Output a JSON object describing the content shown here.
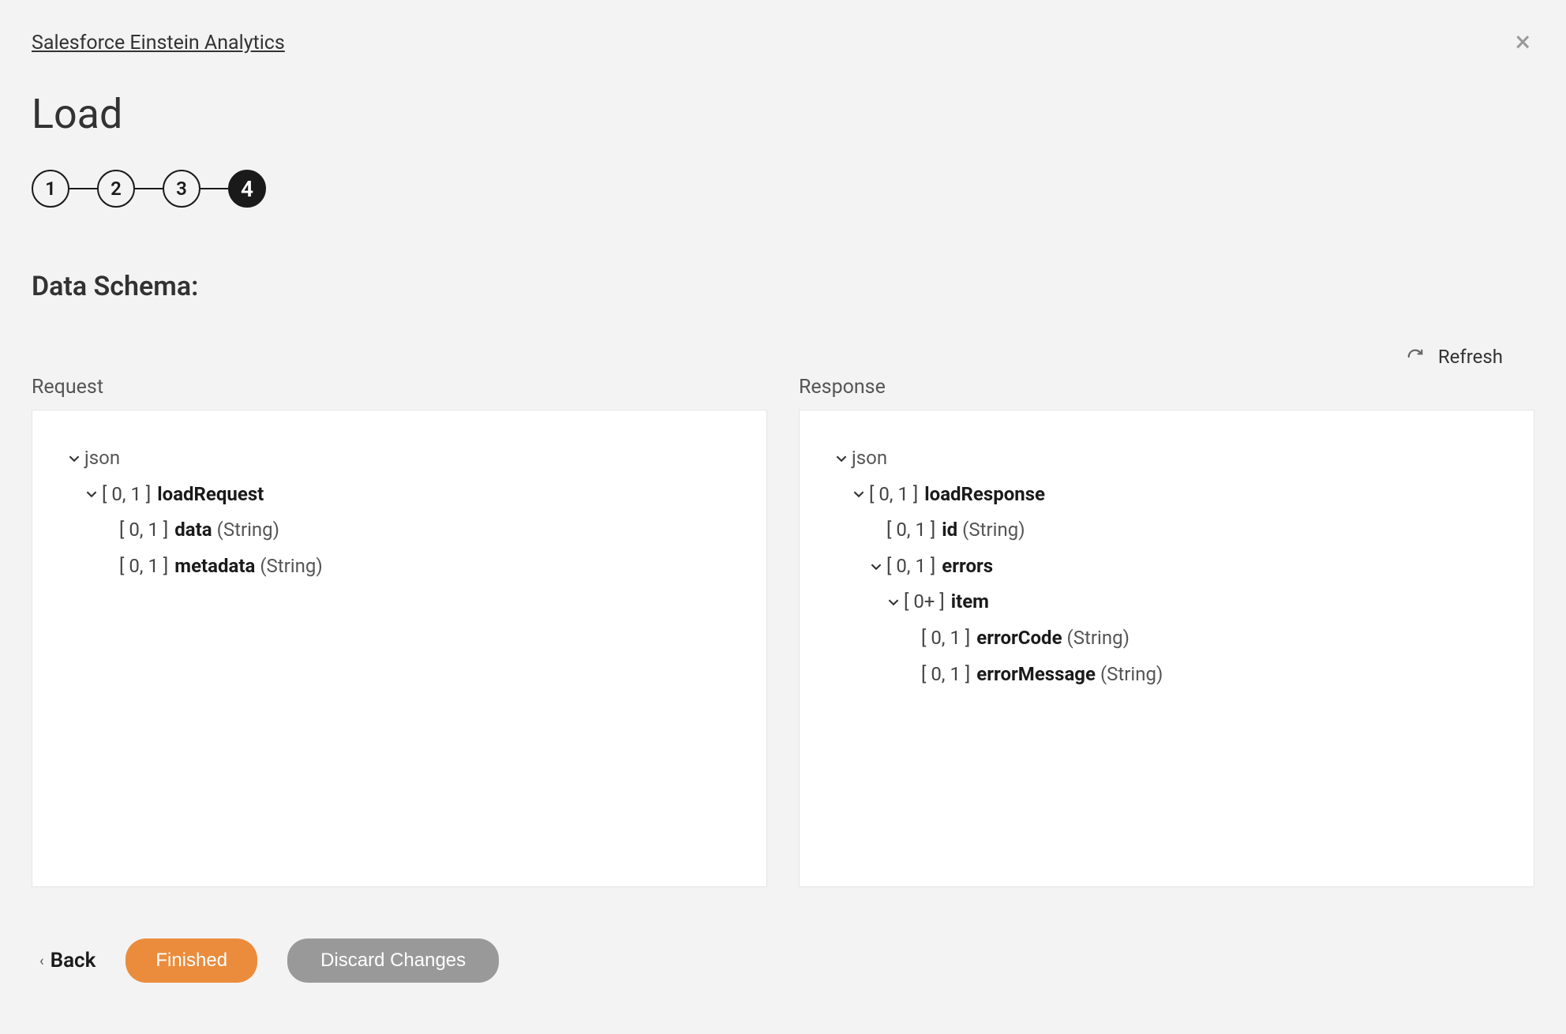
{
  "breadcrumb": "Salesforce Einstein Analytics",
  "page_title": "Load",
  "stepper": [
    {
      "num": "1",
      "active": false
    },
    {
      "num": "2",
      "active": false
    },
    {
      "num": "3",
      "active": false
    },
    {
      "num": "4",
      "active": true
    }
  ],
  "section_title": "Data Schema:",
  "refresh_label": "Refresh",
  "request_label": "Request",
  "response_label": "Response",
  "request_tree": {
    "root": "json",
    "loadRequest": {
      "card": "[ 0, 1 ]",
      "name": "loadRequest"
    },
    "data": {
      "card": "[ 0, 1 ]",
      "name": "data",
      "type": "(String)"
    },
    "metadata": {
      "card": "[ 0, 1 ]",
      "name": "metadata",
      "type": "(String)"
    }
  },
  "response_tree": {
    "root": "json",
    "loadResponse": {
      "card": "[ 0, 1 ]",
      "name": "loadResponse"
    },
    "id": {
      "card": "[ 0, 1 ]",
      "name": "id",
      "type": "(String)"
    },
    "errors": {
      "card": "[ 0, 1 ]",
      "name": "errors"
    },
    "item": {
      "card": "[ 0+ ]",
      "name": "item"
    },
    "errorCode": {
      "card": "[ 0, 1 ]",
      "name": "errorCode",
      "type": "(String)"
    },
    "errorMessage": {
      "card": "[ 0, 1 ]",
      "name": "errorMessage",
      "type": "(String)"
    }
  },
  "footer": {
    "back": "Back",
    "finished": "Finished",
    "discard": "Discard Changes"
  }
}
